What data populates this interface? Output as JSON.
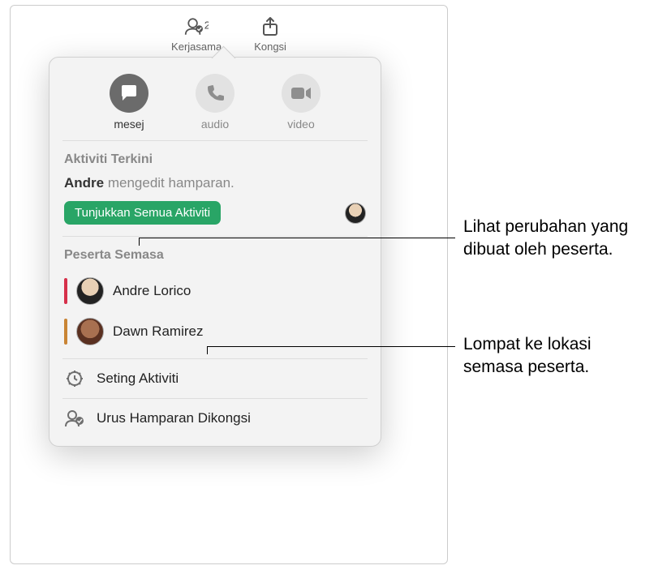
{
  "toolbar": {
    "collaborate": {
      "label": "Kerjasama",
      "count": "2"
    },
    "share": {
      "label": "Kongsi"
    }
  },
  "popover": {
    "comm": {
      "message": "mesej",
      "audio": "audio",
      "video": "video"
    },
    "recent": {
      "header": "Aktiviti Terkini",
      "actor": "Andre",
      "action": " mengedit hamparan.",
      "show_all": "Tunjukkan Semua Aktiviti"
    },
    "participants": {
      "header": "Peserta Semasa",
      "items": [
        {
          "name": "Andre Lorico",
          "color": "#d6304a"
        },
        {
          "name": "Dawn Ramirez",
          "color": "#c98434"
        }
      ]
    },
    "settings": {
      "activity": "Seting Aktiviti",
      "manage": "Urus Hamparan Dikongsi"
    }
  },
  "callouts": {
    "c1": "Lihat perubahan yang dibuat oleh peserta.",
    "c2": "Lompat ke lokasi semasa peserta."
  }
}
